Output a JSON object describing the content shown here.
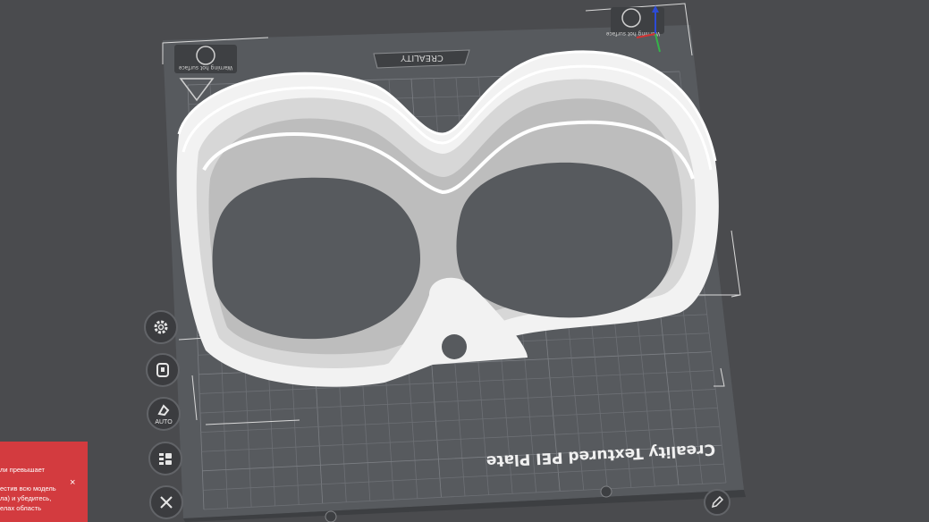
{
  "bed": {
    "plate_label": "Creality Textured PEI Plate",
    "brand": "CREALITY",
    "warning_text": "Warning hot surface"
  },
  "toolbar": {
    "settings_icon": "gear-icon",
    "support_icon": "support-paint-icon",
    "auto_label": "AUTO",
    "list_icon": "layout-list-icon",
    "close_icon": "close-icon"
  },
  "notice": {
    "line1": "ли превышает",
    "line2": "естив всю модель",
    "line3": "ла) и убедитесь,",
    "line4": "елах область",
    "close": "×"
  },
  "colors": {
    "background": "#4a4b4e",
    "bed": "#575a5e",
    "grid": "#6d7075",
    "model": "#f2f2f2",
    "notice": "#d33b3f"
  }
}
